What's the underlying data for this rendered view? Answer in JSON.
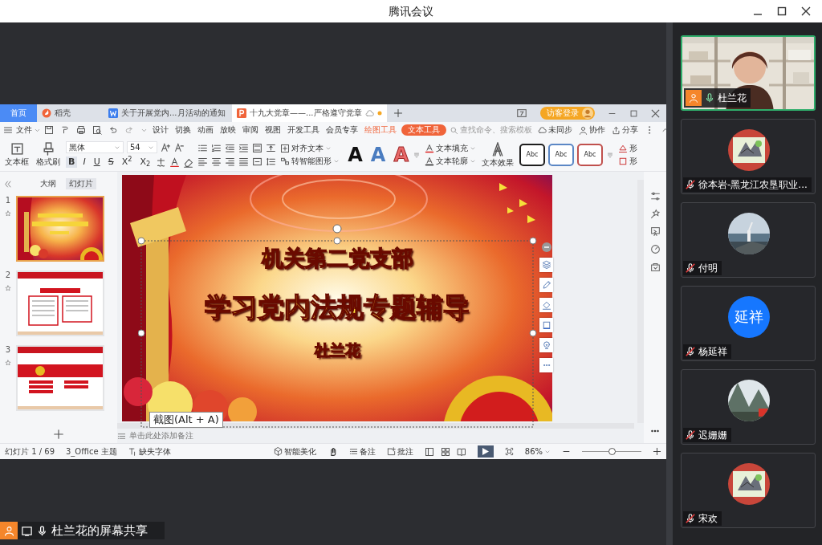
{
  "window": {
    "title": "腾讯会议"
  },
  "presenter_app": {
    "tabs": [
      {
        "label": "首页",
        "kind": "home",
        "selected": false
      },
      {
        "label": "稻壳",
        "kind": "docer",
        "selected": false
      },
      {
        "label": "关于开展党内...月活动的通知",
        "kind": "doc",
        "selected": false
      },
      {
        "label": "十九大党章——...严格遵守党章",
        "kind": "ppt",
        "selected": true
      }
    ],
    "guest_login": "访客登录",
    "file_menu": "文件",
    "ribbon_tabs": [
      {
        "label": "设计",
        "kind": "plain",
        "selected": false
      },
      {
        "label": "切换",
        "kind": "plain",
        "selected": false
      },
      {
        "label": "动画",
        "kind": "plain",
        "selected": false
      },
      {
        "label": "放映",
        "kind": "plain",
        "selected": false
      },
      {
        "label": "审阅",
        "kind": "plain",
        "selected": false
      },
      {
        "label": "视图",
        "kind": "plain",
        "selected": false
      },
      {
        "label": "开发工具",
        "kind": "plain",
        "selected": false
      },
      {
        "label": "会员专享",
        "kind": "plain",
        "selected": false
      },
      {
        "label": "绘图工具",
        "kind": "context",
        "selected": false
      },
      {
        "label": "文本工具",
        "kind": "context",
        "selected": true
      }
    ],
    "search": {
      "placeholder": "查找命令、搜索模板"
    },
    "actions": [
      {
        "label": "未同步",
        "kind": "sync"
      },
      {
        "label": "协作",
        "kind": "collab"
      },
      {
        "label": "分享",
        "kind": "share"
      }
    ],
    "insert_buttons": [
      {
        "label": "文本框",
        "kind": "textbox"
      },
      {
        "label": "格式刷",
        "kind": "brush"
      }
    ],
    "font_name": "黑体",
    "font_size": "54",
    "text_styles": [
      {
        "label": "B",
        "kind": "bold",
        "selected": true
      },
      {
        "label": "I",
        "kind": "italic",
        "selected": false
      },
      {
        "label": "U",
        "kind": "underline",
        "selected": false
      },
      {
        "label": "S",
        "kind": "strike",
        "selected": false
      },
      {
        "label": "X$^{2}$",
        "kind": "sup",
        "selected": false
      },
      {
        "label": "X$_{2}$",
        "kind": "sub",
        "selected": false
      }
    ],
    "paragraph_buttons": [
      {
        "label": "对齐文本",
        "kind": "align"
      },
      {
        "label": "转智能图形",
        "kind": "smart"
      }
    ],
    "wordart_samples": [
      {
        "label": "A",
        "kind": "black"
      },
      {
        "label": "A",
        "kind": "blue"
      },
      {
        "label": "A",
        "kind": "outline"
      }
    ],
    "text_tools": [
      {
        "label": "文本填充",
        "kind": "fill"
      },
      {
        "label": "文本轮廓",
        "kind": "outline"
      }
    ],
    "text_effect": "文本效果",
    "shape_styles": [
      {
        "label": "Abc",
        "color": "#1e1e1e"
      },
      {
        "label": "Abc",
        "color": "#5b87c5"
      },
      {
        "label": "Abc",
        "color": "#c0504d"
      }
    ],
    "shape_tools": [
      {
        "label": "形",
        "kind": "fill"
      },
      {
        "label": "形",
        "kind": "outline"
      }
    ],
    "panel_tabs": [
      {
        "label": "大纲",
        "selected": false
      },
      {
        "label": "幻灯片",
        "selected": true
      }
    ],
    "slides": [
      {
        "number": "1",
        "kind": "title",
        "selected": true
      },
      {
        "number": "2",
        "kind": "text",
        "selected": false
      },
      {
        "number": "3",
        "kind": "list",
        "selected": false
      }
    ],
    "slide": {
      "lines": [
        {
          "text": "机关第二党支部",
          "kind": "heading"
        },
        {
          "text": "学习党内法规专题辅导",
          "kind": "title"
        },
        {
          "text": "杜兰花",
          "kind": "author"
        }
      ]
    },
    "notes_placeholder": "单击此处添加备注",
    "tooltip": "截图(Alt + A)",
    "status_bar": {
      "slide_count": "幻灯片 1 / 69",
      "theme": "3_Office 主题",
      "missing_fonts": "缺失字体",
      "tools": [
        {
          "label": "智能美化",
          "kind": "beautify"
        },
        {
          "label": "备注",
          "kind": "notes"
        },
        {
          "label": "批注",
          "kind": "comment"
        }
      ],
      "zoom": "86%",
      "zoom_slider": {
        "level": 0.5
      }
    }
  },
  "participants": [
    {
      "name": "杜兰花",
      "kind": "video",
      "host": true,
      "speaking": true,
      "muted": false
    },
    {
      "name": "徐本岩-黑龙江农垦职业...",
      "host": false,
      "speaking": false,
      "muted": true
    },
    {
      "name": "付明",
      "host": false,
      "speaking": false,
      "muted": true
    },
    {
      "name": "杨延祥",
      "kind": "initials",
      "avatar_text": "延祥",
      "host": false,
      "speaking": false,
      "muted": true
    },
    {
      "name": "迟姗姗",
      "host": false,
      "speaking": false,
      "muted": true
    },
    {
      "name": "宋欢",
      "host": false,
      "speaking": false,
      "muted": true
    }
  ],
  "screen_share": {
    "label": "杜兰花的屏幕共享"
  }
}
